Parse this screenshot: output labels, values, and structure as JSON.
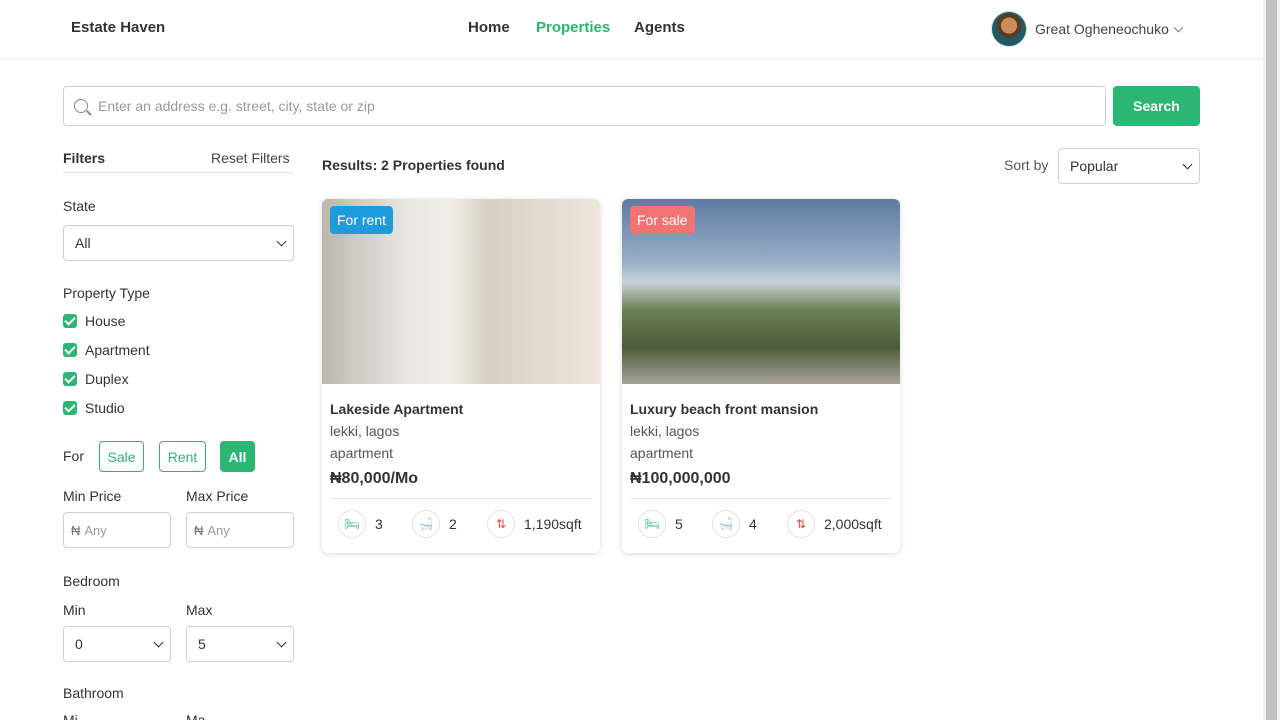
{
  "header": {
    "brand": "Estate Haven",
    "nav": [
      {
        "label": "Home",
        "active": false
      },
      {
        "label": "Properties",
        "active": true
      },
      {
        "label": "Agents",
        "active": false
      }
    ],
    "user_name": "Great Ogheneochuko"
  },
  "search": {
    "placeholder": "Enter an address e.g. street, city, state or zip",
    "value": "",
    "button": "Search"
  },
  "filters": {
    "title": "Filters",
    "reset": "Reset Filters",
    "state_label": "State",
    "state_value": "All",
    "property_type_label": "Property Type",
    "property_types": [
      {
        "label": "House",
        "checked": true
      },
      {
        "label": "Apartment",
        "checked": true
      },
      {
        "label": "Duplex",
        "checked": true
      },
      {
        "label": "Studio",
        "checked": true
      }
    ],
    "for_label": "For",
    "for_options": [
      {
        "label": "Sale",
        "active": false
      },
      {
        "label": "Rent",
        "active": false
      },
      {
        "label": "All",
        "active": true
      }
    ],
    "min_price_label": "Min Price",
    "max_price_label": "Max Price",
    "currency_symbol": "₦",
    "price_placeholder": "Any",
    "bedroom_label": "Bedroom",
    "min_label": "Min",
    "max_label": "Max",
    "bedroom_min": "0",
    "bedroom_max": "5",
    "bathroom_label": "Bathroom",
    "bathroom_min_label": "Mi",
    "bathroom_max_label": "Ma"
  },
  "results": {
    "text": "Results: 2 Properties found",
    "sort_label": "Sort by",
    "sort_value": "Popular"
  },
  "listings": [
    {
      "badge": "For rent",
      "title": "Lakeside Apartment",
      "location": "lekki, lagos",
      "type": "apartment",
      "price": "₦80,000/Mo",
      "bedrooms": "3",
      "bathrooms": "2",
      "area": "1,190sqft"
    },
    {
      "badge": "For sale",
      "title": "Luxury beach front mansion",
      "location": "lekki, lagos",
      "type": "apartment",
      "price": "₦100,000,000",
      "bedrooms": "5",
      "bathrooms": "4",
      "area": "2,000sqft"
    }
  ],
  "colors": {
    "accent": "#2bb673",
    "rent_badge": "#1e9bdb",
    "sale_badge": "#f07474"
  },
  "icons": [
    "search-icon",
    "chevron-down-icon",
    "checkbox-checked-icon",
    "bed-icon",
    "bath-icon",
    "area-icon"
  ]
}
